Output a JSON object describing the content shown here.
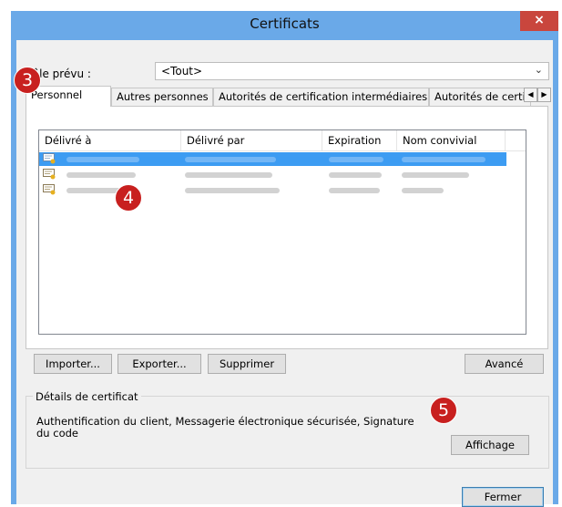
{
  "window": {
    "title": "Certificats",
    "close_label": "×"
  },
  "role": {
    "label": "Rôle prévu :",
    "value": "<Tout>"
  },
  "tabs": [
    "Personnel",
    "Autres personnes",
    "Autorités de certification intermédiaires",
    "Autorités de certification racines de confiance"
  ],
  "tab_scroll": {
    "left": "◀",
    "right": "▶"
  },
  "list": {
    "columns": [
      "Délivré à",
      "Délivré par",
      "Expiration",
      "Nom convivial"
    ]
  },
  "buttons": {
    "import": "Importer...",
    "export": "Exporter...",
    "delete": "Supprimer",
    "advanced": "Avancé",
    "view": "Affichage",
    "close": "Fermer"
  },
  "details": {
    "title": "Détails de certificat",
    "text": "Authentification du client, Messagerie électronique sécurisée, Signature du code"
  },
  "badges": {
    "b3": "3",
    "b4": "4",
    "b5": "5"
  },
  "colors": {
    "accent": "#3d9cf2",
    "badge": "#c8201f",
    "close": "#c9463d",
    "frame": "#6aa9e8"
  }
}
